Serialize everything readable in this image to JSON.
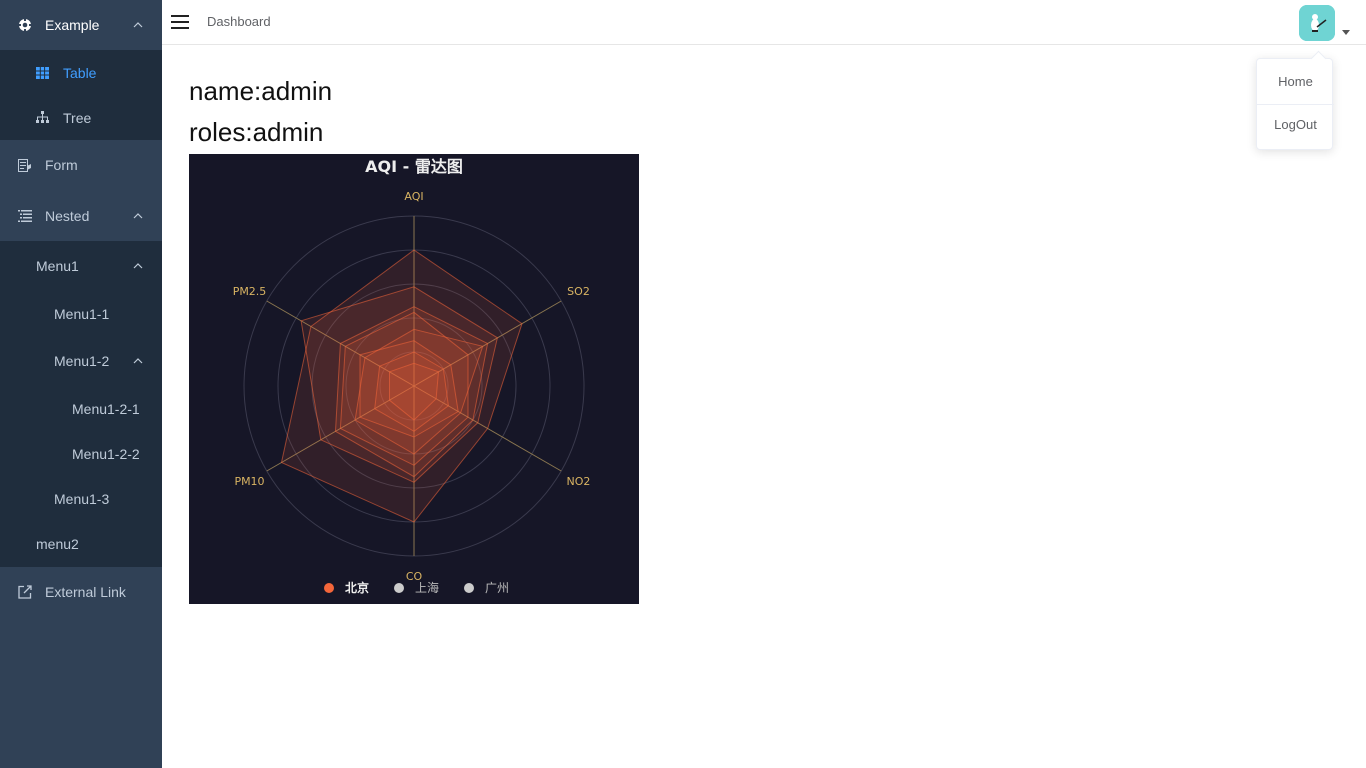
{
  "sidebar": {
    "items": [
      {
        "label": "Example",
        "icon": "example-icon"
      },
      {
        "label": "Table",
        "icon": "table-icon"
      },
      {
        "label": "Tree",
        "icon": "tree-icon"
      },
      {
        "label": "Form",
        "icon": "form-icon"
      },
      {
        "label": "Nested",
        "icon": "nested-icon"
      },
      {
        "label": "Menu1"
      },
      {
        "label": "Menu1-1"
      },
      {
        "label": "Menu1-2"
      },
      {
        "label": "Menu1-2-1"
      },
      {
        "label": "Menu1-2-2"
      },
      {
        "label": "Menu1-3"
      },
      {
        "label": "menu2"
      },
      {
        "label": "External Link",
        "icon": "external-link-icon"
      }
    ],
    "active_item": "Table",
    "active_color": "#409eff",
    "text_color": "#bfcbd9",
    "background": "#304156"
  },
  "navbar": {
    "breadcrumb": "Dashboard",
    "menu_icon": "hamburger-icon",
    "avatar_icon": "avatar-icon"
  },
  "dropdown": {
    "items": [
      "Home",
      "LogOut"
    ]
  },
  "user": {
    "name_line": "name:admin",
    "roles_line": "roles:admin"
  },
  "chart_data": {
    "type": "radar",
    "title": "AQI - 雷达图",
    "indicators": [
      "AQI",
      "SO2",
      "NO2",
      "CO",
      "PM10",
      "PM2.5"
    ],
    "max": 300,
    "legend": [
      "北京",
      "上海",
      "广州"
    ],
    "legend_selected": [
      "北京"
    ],
    "legend_placement": "bottom",
    "series": [
      {
        "name": "北京",
        "color": "#f4663a",
        "values": [
          [
            240,
            220,
            150,
            240,
            270,
            210
          ],
          [
            175,
            170,
            130,
            170,
            190,
            230
          ],
          [
            130,
            110,
            110,
            140,
            150,
            140
          ],
          [
            100,
            140,
            95,
            120,
            120,
            100
          ],
          [
            80,
            75,
            90,
            90,
            110,
            110
          ],
          [
            140,
            150,
            120,
            160,
            160,
            150
          ],
          [
            60,
            60,
            70,
            80,
            80,
            70
          ],
          [
            40,
            50,
            45,
            60,
            50,
            50
          ]
        ]
      }
    ]
  }
}
